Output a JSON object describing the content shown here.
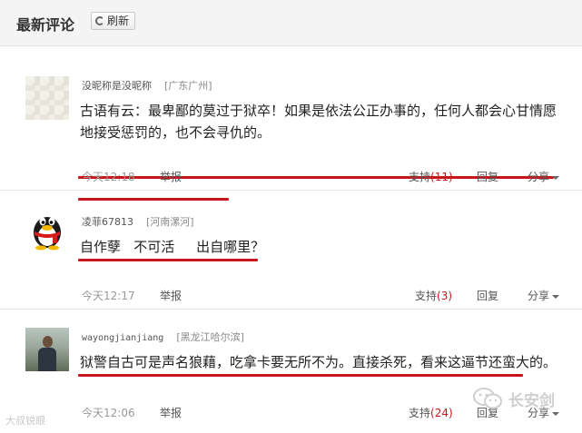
{
  "header": {
    "title": "最新评论",
    "refresh_label": "刷新"
  },
  "comments": [
    {
      "user": "没昵称是没昵称",
      "location": "[广东广州]",
      "text": "古语有云：最卑鄙的莫过于狱卒！如果是依法公正办事的，任何人都会心甘情愿地接受惩罚的，也不会寻仇的。",
      "time": "今天12:18",
      "report": "举报",
      "support_label": "支持",
      "support_count": "(11)",
      "reply": "回复",
      "share": "分享"
    },
    {
      "user": "凌菲67813",
      "location": "[河南漯河]",
      "text": "自作孽   不可活     出自哪里？",
      "time": "今天12:17",
      "report": "举报",
      "support_label": "支持",
      "support_count": "(3)",
      "reply": "回复",
      "share": "分享"
    },
    {
      "user": "wayongjianjiang",
      "location": "[黑龙江哈尔滨]",
      "text": "狱警自古可是声名狼藉，吃拿卡要无所不为。直接杀死，看来这逼节还蛮大的。",
      "time": "今天12:06",
      "report": "举报",
      "support_label": "支持",
      "support_count": "(24)",
      "reply": "回复",
      "share": "分享"
    }
  ],
  "watermarks": {
    "left": "大叔锐眼",
    "right": "长安剑"
  },
  "colors": {
    "accent_red": "#c8141b",
    "header_bg": "#f4f4f4"
  },
  "icons": [
    "refresh-icon",
    "avatar-lace",
    "qq-penguin-avatar",
    "avatar-photo",
    "caret-down-icon",
    "wechat-icon"
  ]
}
